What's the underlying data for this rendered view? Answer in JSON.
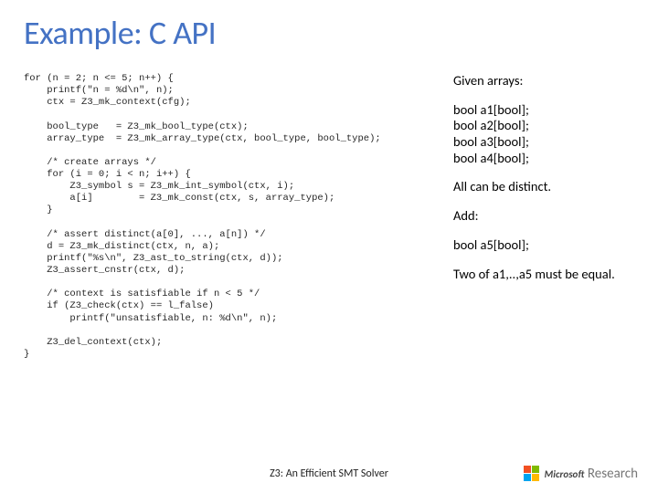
{
  "title_prefix": "Example: ",
  "title_main": "C API",
  "code": "for (n = 2; n <= 5; n++) {\n    printf(\"n = %d\\n\", n);\n    ctx = Z3_mk_context(cfg);\n\n    bool_type   = Z3_mk_bool_type(ctx);\n    array_type  = Z3_mk_array_type(ctx, bool_type, bool_type);\n\n    /* create arrays */\n    for (i = 0; i < n; i++) {\n        Z3_symbol s = Z3_mk_int_symbol(ctx, i);\n        a[i]        = Z3_mk_const(ctx, s, array_type);\n    }\n\n    /* assert distinct(a[0], ..., a[n]) */\n    d = Z3_mk_distinct(ctx, n, a);\n    printf(\"%s\\n\", Z3_ast_to_string(ctx, d));\n    Z3_assert_cnstr(ctx, d);\n\n    /* context is satisfiable if n < 5 */\n    if (Z3_check(ctx) == l_false)\n        printf(\"unsatisfiable, n: %d\\n\", n);\n\n    Z3_del_context(ctx);\n}",
  "right": {
    "line1": "Given arrays:",
    "decls": "bool a1[bool];\nbool a2[bool];\nbool a3[bool];\nbool a4[bool];",
    "line2": "All can be distinct.",
    "line3": "Add:",
    "line4": "bool a5[bool];",
    "line5": "Two of a1,..,a5 must be equal."
  },
  "footer": "Z3: An Efficient SMT Solver",
  "logo_brand": "Microsoft",
  "logo_sub": "Research"
}
